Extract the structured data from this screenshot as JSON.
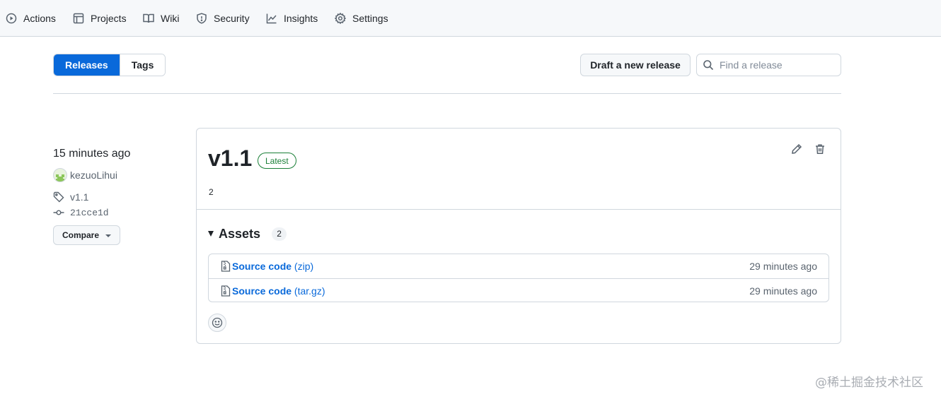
{
  "repo_nav": {
    "items": [
      {
        "label": "Actions",
        "icon": "play-icon"
      },
      {
        "label": "Projects",
        "icon": "table-icon"
      },
      {
        "label": "Wiki",
        "icon": "book-icon"
      },
      {
        "label": "Security",
        "icon": "shield-icon"
      },
      {
        "label": "Insights",
        "icon": "graph-icon"
      },
      {
        "label": "Settings",
        "icon": "gear-icon"
      }
    ]
  },
  "subnav": {
    "releases_label": "Releases",
    "tags_label": "Tags",
    "selected": "Releases"
  },
  "toolbar": {
    "draft_label": "Draft a new release",
    "search_placeholder": "Find a release",
    "search_value": ""
  },
  "release": {
    "time_ago": "15 minutes ago",
    "author": "kezuoLihui",
    "tag": "v1.1",
    "commit": "21cce1d",
    "compare_label": "Compare",
    "title": "v1.1",
    "badge": "Latest",
    "body": "2",
    "assets": {
      "title": "Assets",
      "count": "2",
      "items": [
        {
          "name": "Source code",
          "ext": "(zip)",
          "time": "29 minutes ago"
        },
        {
          "name": "Source code",
          "ext": "(tar.gz)",
          "time": "29 minutes ago"
        }
      ]
    }
  },
  "watermark": "@稀土掘金技术社区",
  "colors": {
    "accent": "#0969da",
    "latest_green": "#1a7f37",
    "border": "#d0d7de"
  }
}
